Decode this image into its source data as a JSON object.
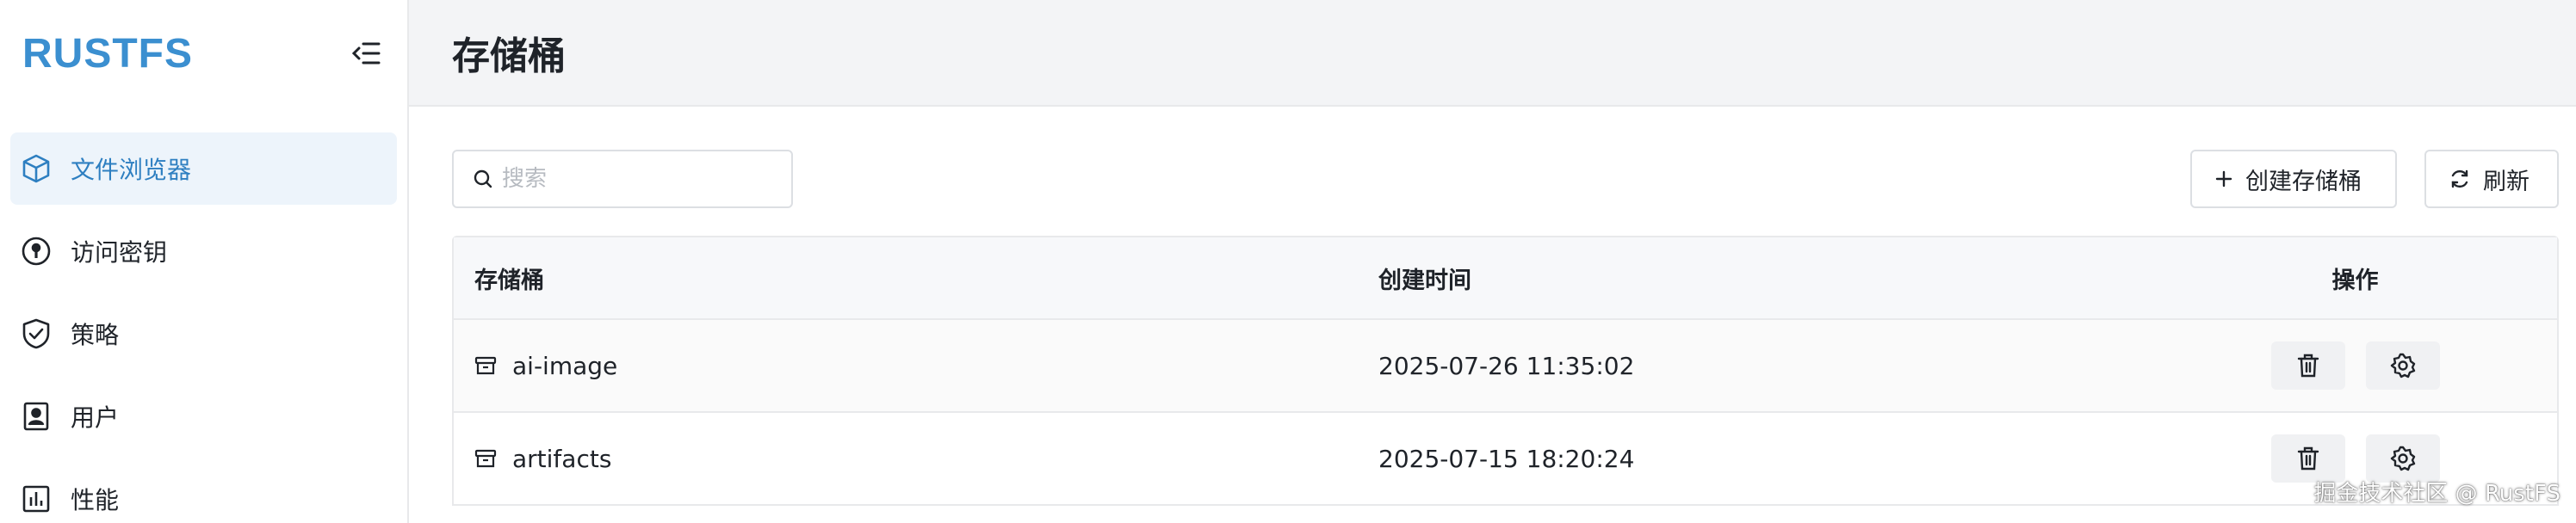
{
  "app": {
    "logo": "RUSTFS"
  },
  "sidebar": {
    "items": [
      {
        "label": "文件浏览器",
        "icon": "cube-icon",
        "active": true
      },
      {
        "label": "访问密钥",
        "icon": "key-icon",
        "active": false
      },
      {
        "label": "策略",
        "icon": "shield-check-icon",
        "active": false
      },
      {
        "label": "用户",
        "icon": "user-card-icon",
        "active": false
      },
      {
        "label": "性能",
        "icon": "bar-chart-icon",
        "active": false
      }
    ]
  },
  "header": {
    "title": "存储桶"
  },
  "toolbar": {
    "search_placeholder": "搜索",
    "create_label": "创建存储桶",
    "refresh_label": "刷新"
  },
  "table": {
    "columns": [
      "存储桶",
      "创建时间",
      "操作"
    ],
    "rows": [
      {
        "name": "ai-image",
        "created": "2025-07-26 11:35:02"
      },
      {
        "name": "artifacts",
        "created": "2025-07-15 18:20:24"
      }
    ]
  },
  "watermark": "掘金技术社区 @ RustFS",
  "colors": {
    "accent": "#3b8fd0",
    "active_bg": "#edf4fb",
    "header_bg": "#f3f4f6"
  }
}
